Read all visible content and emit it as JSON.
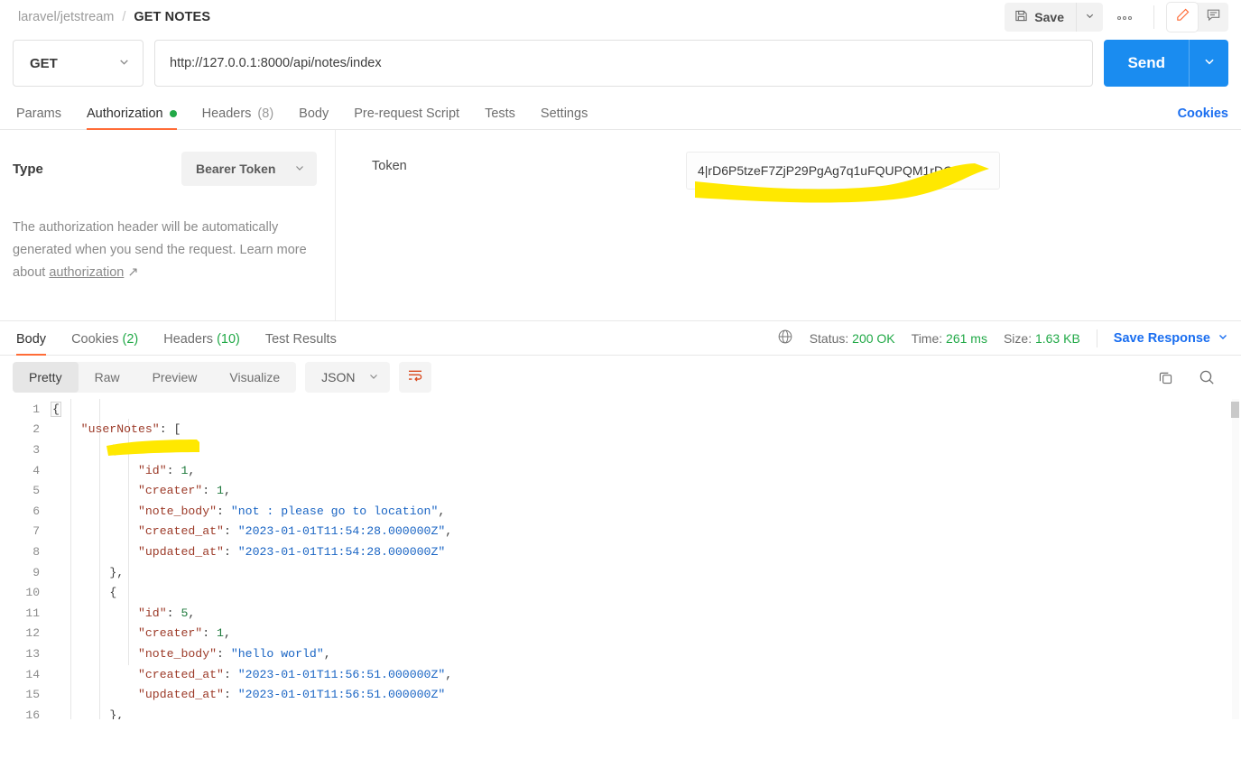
{
  "topbar": {
    "collection": "laravel/jetstream",
    "separator": "/",
    "request_name": "GET NOTES",
    "save_label": "Save",
    "save_caret_icon": "chevron-down-icon",
    "more_icon": "ellipsis-icon",
    "more_label": "●●●",
    "edit_icon": "pencil-icon",
    "comment_icon": "comment-icon"
  },
  "request": {
    "method": "GET",
    "method_caret_icon": "chevron-down-icon",
    "url": "http://127.0.0.1:8000/api/notes/index",
    "send_label": "Send",
    "send_caret_icon": "chevron-down-icon",
    "tabs": [
      {
        "label": "Params",
        "badge": "",
        "active": false,
        "dot": false
      },
      {
        "label": "Authorization",
        "badge": "",
        "active": true,
        "dot": true
      },
      {
        "label": "Headers",
        "badge": "(8)",
        "active": false,
        "dot": false
      },
      {
        "label": "Body",
        "badge": "",
        "active": false,
        "dot": false
      },
      {
        "label": "Pre-request Script",
        "badge": "",
        "active": false,
        "dot": false
      },
      {
        "label": "Tests",
        "badge": "",
        "active": false,
        "dot": false
      },
      {
        "label": "Settings",
        "badge": "",
        "active": false,
        "dot": false
      }
    ],
    "cookies_link": "Cookies"
  },
  "auth": {
    "type_label": "Type",
    "type_value": "Bearer Token",
    "type_caret_icon": "chevron-down-icon",
    "help_text_1": "The authorization header will be automatically generated when you send the request. Learn more about ",
    "help_link": "authorization",
    "help_link_icon": "external-link-arrow-icon",
    "token_label": "Token",
    "token_value": "4|rD6P5tzeF7ZjP29PgAg7q1uFQUPQM1rDC…",
    "highlight_color": "#FFE800"
  },
  "response": {
    "tabs": [
      {
        "label": "Body",
        "badge": "",
        "active": true
      },
      {
        "label": "Cookies",
        "badge": "(2)",
        "active": false
      },
      {
        "label": "Headers",
        "badge": "(10)",
        "active": false
      },
      {
        "label": "Test Results",
        "badge": "",
        "active": false
      }
    ],
    "globe_icon": "globe-icon",
    "status_label": "Status:",
    "status_value": "200 OK",
    "time_label": "Time:",
    "time_value": "261 ms",
    "size_label": "Size:",
    "size_value": "1.63 KB",
    "save_response_label": "Save Response",
    "save_response_caret_icon": "chevron-down-icon",
    "formats": [
      {
        "label": "Pretty",
        "active": true
      },
      {
        "label": "Raw",
        "active": false
      },
      {
        "label": "Preview",
        "active": false
      },
      {
        "label": "Visualize",
        "active": false
      }
    ],
    "language": "JSON",
    "language_caret_icon": "chevron-down-icon",
    "wrap_icon": "word-wrap-icon",
    "copy_icon": "copy-icon",
    "search_icon": "search-icon",
    "accent_color": "#FF6C37",
    "link_color": "#1A6EF0",
    "success_color": "#21A947"
  },
  "code": {
    "highlight_color": "#FFE800",
    "lines": [
      {
        "n": "1",
        "indent": 0,
        "tokens": [
          {
            "t": "{",
            "c": "fold"
          }
        ]
      },
      {
        "n": "2",
        "indent": 1,
        "tokens": [
          {
            "t": "\"userNotes\"",
            "c": "k"
          },
          {
            "t": ": [",
            "c": "p"
          }
        ]
      },
      {
        "n": "3",
        "indent": 2,
        "tokens": [
          {
            "t": "{",
            "c": "p"
          }
        ]
      },
      {
        "n": "4",
        "indent": 3,
        "tokens": [
          {
            "t": "\"id\"",
            "c": "k"
          },
          {
            "t": ": ",
            "c": "p"
          },
          {
            "t": "1",
            "c": "n"
          },
          {
            "t": ",",
            "c": "p"
          }
        ]
      },
      {
        "n": "5",
        "indent": 3,
        "tokens": [
          {
            "t": "\"creater\"",
            "c": "k"
          },
          {
            "t": ": ",
            "c": "p"
          },
          {
            "t": "1",
            "c": "n"
          },
          {
            "t": ",",
            "c": "p"
          }
        ]
      },
      {
        "n": "6",
        "indent": 3,
        "tokens": [
          {
            "t": "\"note_body\"",
            "c": "k"
          },
          {
            "t": ": ",
            "c": "p"
          },
          {
            "t": "\"not : please go to location\"",
            "c": "s"
          },
          {
            "t": ",",
            "c": "p"
          }
        ]
      },
      {
        "n": "7",
        "indent": 3,
        "tokens": [
          {
            "t": "\"created_at\"",
            "c": "k"
          },
          {
            "t": ": ",
            "c": "p"
          },
          {
            "t": "\"2023-01-01T11:54:28.000000Z\"",
            "c": "s"
          },
          {
            "t": ",",
            "c": "p"
          }
        ]
      },
      {
        "n": "8",
        "indent": 3,
        "tokens": [
          {
            "t": "\"updated_at\"",
            "c": "k"
          },
          {
            "t": ": ",
            "c": "p"
          },
          {
            "t": "\"2023-01-01T11:54:28.000000Z\"",
            "c": "s"
          }
        ]
      },
      {
        "n": "9",
        "indent": 2,
        "tokens": [
          {
            "t": "},",
            "c": "p"
          }
        ]
      },
      {
        "n": "10",
        "indent": 2,
        "tokens": [
          {
            "t": "{",
            "c": "p"
          }
        ]
      },
      {
        "n": "11",
        "indent": 3,
        "tokens": [
          {
            "t": "\"id\"",
            "c": "k"
          },
          {
            "t": ": ",
            "c": "p"
          },
          {
            "t": "5",
            "c": "n"
          },
          {
            "t": ",",
            "c": "p"
          }
        ]
      },
      {
        "n": "12",
        "indent": 3,
        "tokens": [
          {
            "t": "\"creater\"",
            "c": "k"
          },
          {
            "t": ": ",
            "c": "p"
          },
          {
            "t": "1",
            "c": "n"
          },
          {
            "t": ",",
            "c": "p"
          }
        ]
      },
      {
        "n": "13",
        "indent": 3,
        "tokens": [
          {
            "t": "\"note_body\"",
            "c": "k"
          },
          {
            "t": ": ",
            "c": "p"
          },
          {
            "t": "\"hello world\"",
            "c": "s"
          },
          {
            "t": ",",
            "c": "p"
          }
        ]
      },
      {
        "n": "14",
        "indent": 3,
        "tokens": [
          {
            "t": "\"created_at\"",
            "c": "k"
          },
          {
            "t": ": ",
            "c": "p"
          },
          {
            "t": "\"2023-01-01T11:56:51.000000Z\"",
            "c": "s"
          },
          {
            "t": ",",
            "c": "p"
          }
        ]
      },
      {
        "n": "15",
        "indent": 3,
        "tokens": [
          {
            "t": "\"updated_at\"",
            "c": "k"
          },
          {
            "t": ": ",
            "c": "p"
          },
          {
            "t": "\"2023-01-01T11:56:51.000000Z\"",
            "c": "s"
          }
        ]
      },
      {
        "n": "16",
        "indent": 2,
        "tokens": [
          {
            "t": "},",
            "c": "p"
          }
        ]
      }
    ]
  }
}
